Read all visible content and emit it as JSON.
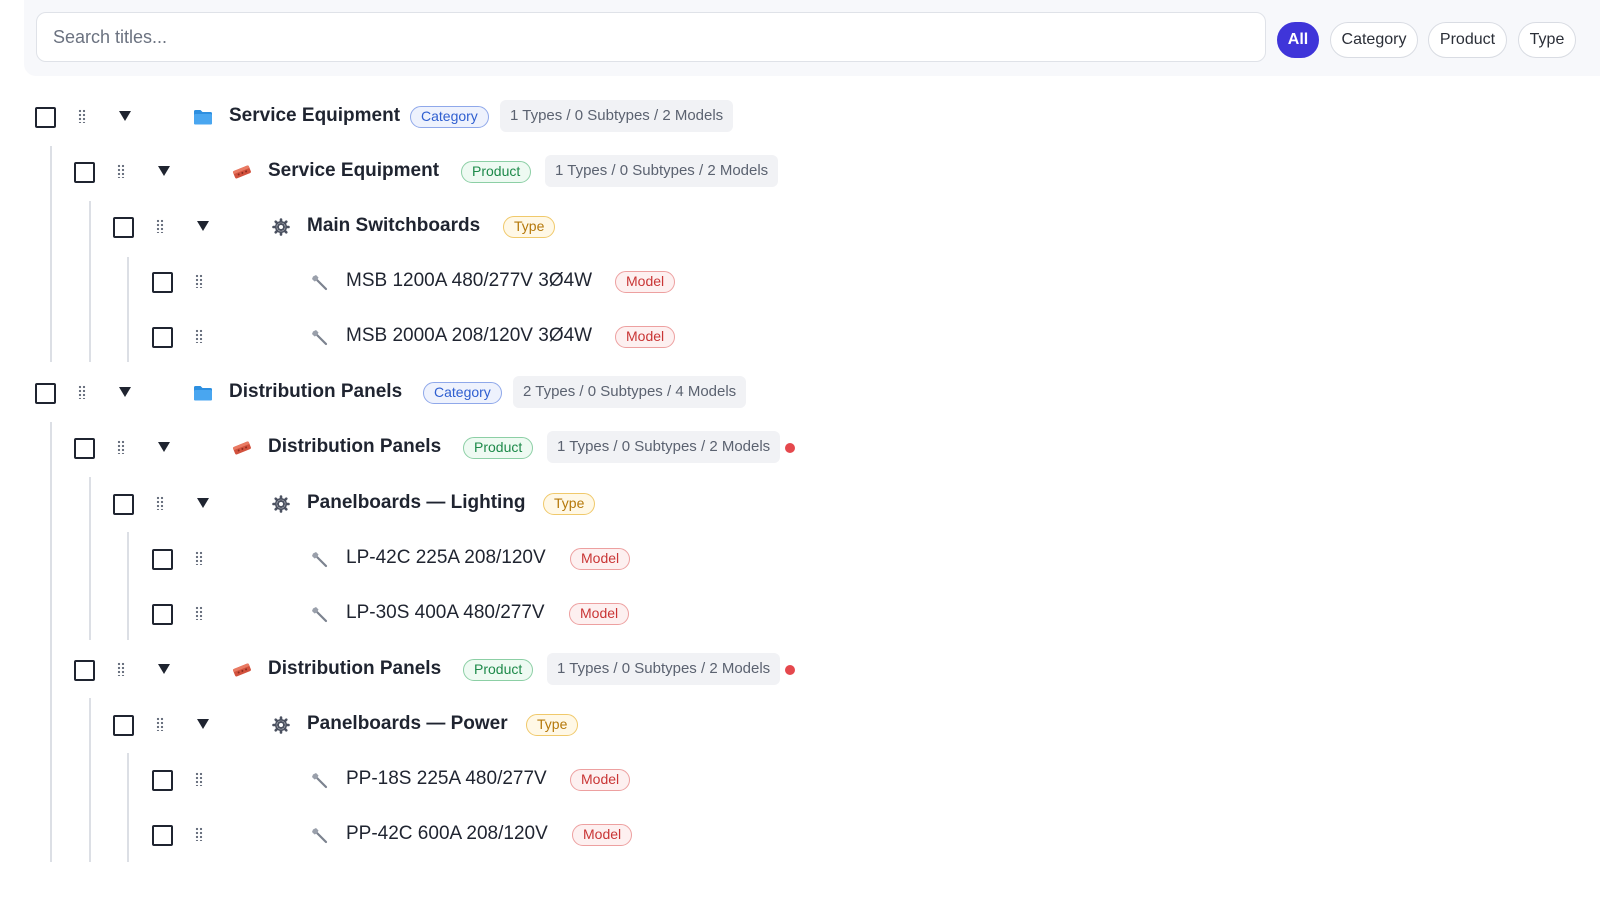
{
  "search": {
    "placeholder": "Search titles..."
  },
  "filters": [
    "All",
    "Category",
    "Product",
    "Type"
  ],
  "badges": {
    "category": "Category",
    "product": "Product",
    "type": "Type",
    "model": "Model"
  },
  "rows": [
    {
      "level": 0,
      "kind": "category",
      "title": "Service Equipment",
      "counts": "1 Types / 0 Subtypes / 2 Models",
      "flag": false
    },
    {
      "level": 1,
      "kind": "product",
      "title": "Service Equipment",
      "counts": "1 Types / 0 Subtypes / 2 Models",
      "flag": false
    },
    {
      "level": 2,
      "kind": "type",
      "title": "Main Switchboards"
    },
    {
      "level": 3,
      "kind": "model",
      "title": "MSB 1200A 480/277V 3Ø4W"
    },
    {
      "level": 3,
      "kind": "model",
      "title": "MSB 2000A 208/120V 3Ø4W"
    },
    {
      "level": 0,
      "kind": "category",
      "title": "Distribution Panels",
      "counts": "2 Types / 0 Subtypes / 4 Models",
      "flag": false
    },
    {
      "level": 1,
      "kind": "product",
      "title": "Distribution Panels",
      "counts": "1 Types / 0 Subtypes / 2 Models",
      "flag": true
    },
    {
      "level": 2,
      "kind": "type",
      "title": "Panelboards — Lighting"
    },
    {
      "level": 3,
      "kind": "model",
      "title": "LP-42C 225A 208/120V"
    },
    {
      "level": 3,
      "kind": "model",
      "title": "LP-30S 400A 480/277V"
    },
    {
      "level": 1,
      "kind": "product",
      "title": "Distribution Panels",
      "counts": "1 Types / 0 Subtypes / 2 Models",
      "flag": true
    },
    {
      "level": 2,
      "kind": "type",
      "title": "Panelboards — Power"
    },
    {
      "level": 3,
      "kind": "model",
      "title": "PP-18S 225A 480/277V"
    },
    {
      "level": 3,
      "kind": "model",
      "title": "PP-42C 600A 208/120V"
    }
  ],
  "colors": {
    "accent": "#3f35d9",
    "category": "#2f5fd0",
    "product": "#1e8a4a",
    "type": "#b5780a",
    "model": "#c93535",
    "flag": "#e5484d"
  },
  "icons": {
    "category": "folder-icon",
    "product": "brick-icon",
    "type": "gear-icon",
    "model": "wrench-icon"
  }
}
